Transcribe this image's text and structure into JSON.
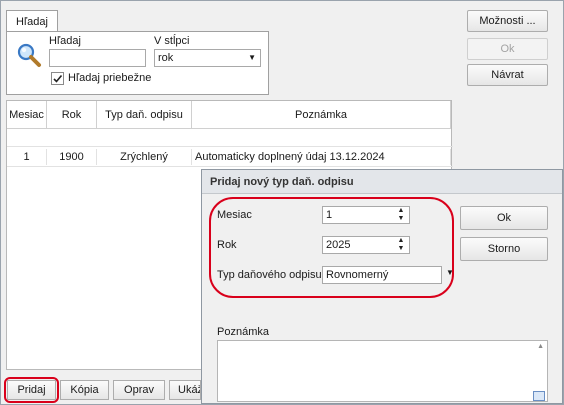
{
  "search": {
    "tab_label": "Hľadaj",
    "search_label": "Hľadaj",
    "search_value": "",
    "column_label": "V stĺpci",
    "column_value": "rok",
    "continuous_label": "Hľadaj priebežne",
    "continuous_checked": true
  },
  "right_buttons": {
    "options": "Možnosti ...",
    "ok": "Ok",
    "back": "Návrat"
  },
  "grid": {
    "columns": [
      "Mesiac",
      "Rok",
      "Typ daň. odpisu",
      "Poznámka"
    ],
    "rows": [
      [
        "1",
        "1900",
        "Zrýchlený",
        "Automaticky doplnený údaj 13.12.2024"
      ]
    ]
  },
  "bottom_buttons": {
    "add": "Pridaj",
    "copy": "Kópia",
    "edit": "Oprav",
    "show": "Ukáž"
  },
  "dialog": {
    "title": "Pridaj nový typ daň. odpisu",
    "month_label": "Mesiac",
    "month_value": "1",
    "year_label": "Rok",
    "year_value": "2025",
    "type_label": "Typ daňového odpisu",
    "type_value": "Rovnomerný",
    "note_label": "Poznámka",
    "note_value": "",
    "ok": "Ok",
    "cancel": "Storno"
  },
  "colors": {
    "highlight_red": "#d9001b"
  }
}
